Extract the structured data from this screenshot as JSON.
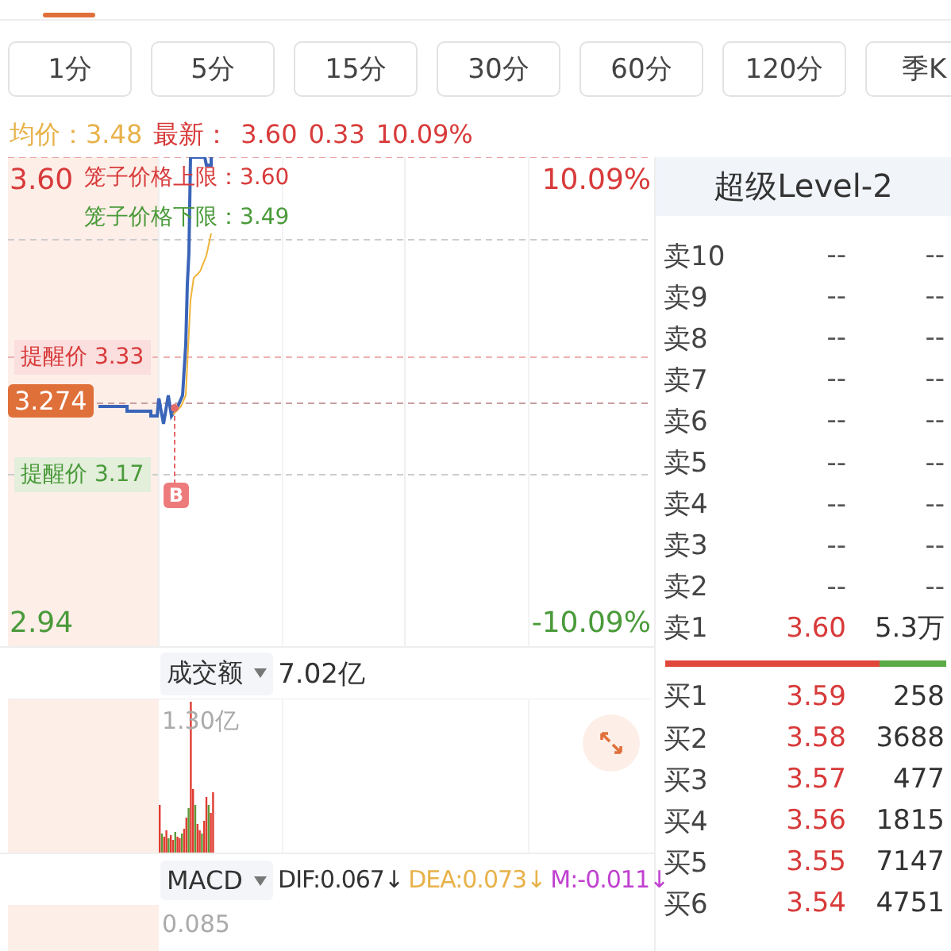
{
  "periods": [
    {
      "label": "1分",
      "selected": false
    },
    {
      "label": "5分",
      "selected": false
    },
    {
      "label": "15分",
      "selected": false
    },
    {
      "label": "30分",
      "selected": false
    },
    {
      "label": "60分",
      "selected": false
    },
    {
      "label": "120分",
      "selected": false
    },
    {
      "label": "季K",
      "selected": false
    }
  ],
  "quote_line": {
    "avg_label": "均价：",
    "avg_value": "3.48",
    "latest_label": "最新：",
    "latest_price": "3.60",
    "change": "0.33",
    "change_pct": "10.09%"
  },
  "price_chart": {
    "top_price": "3.60",
    "top_pct": "10.09%",
    "bottom_price": "2.94",
    "bottom_pct": "-10.09%",
    "cage_upper": "笼子价格上限：3.60",
    "cage_lower": "笼子价格下限：3.49",
    "alerts": [
      {
        "label": "提醒价 3.33",
        "kind": "upper"
      },
      {
        "label": "提醒价 3.17",
        "kind": "lower"
      }
    ],
    "current_price_tag": "3.274",
    "trade_marker": "B"
  },
  "volume_panel": {
    "indicator": "成交额",
    "value": "7.02亿",
    "max_label": "1.30亿"
  },
  "macd_panel": {
    "indicator": "MACD",
    "dif": "DIF:0.067↓",
    "dea": "DEA:0.073↓",
    "m": "M:-0.011↓",
    "max_label": "0.085"
  },
  "order_book": {
    "title": "超级Level-2",
    "asks": [
      {
        "label": "卖10",
        "price": "--",
        "volume": "--",
        "kind": "empty"
      },
      {
        "label": "卖9",
        "price": "--",
        "volume": "--",
        "kind": "empty"
      },
      {
        "label": "卖8",
        "price": "--",
        "volume": "--",
        "kind": "empty"
      },
      {
        "label": "卖7",
        "price": "--",
        "volume": "--",
        "kind": "empty"
      },
      {
        "label": "卖6",
        "price": "--",
        "volume": "--",
        "kind": "empty"
      },
      {
        "label": "卖5",
        "price": "--",
        "volume": "--",
        "kind": "empty"
      },
      {
        "label": "卖4",
        "price": "--",
        "volume": "--",
        "kind": "empty"
      },
      {
        "label": "卖3",
        "price": "--",
        "volume": "--",
        "kind": "empty"
      },
      {
        "label": "卖2",
        "price": "--",
        "volume": "--",
        "kind": "empty"
      },
      {
        "label": "卖1",
        "price": "3.60",
        "volume": "5.3万",
        "kind": "quote"
      }
    ],
    "ratio_bar": {
      "level": 0.76
    },
    "bids": [
      {
        "label": "买1",
        "price": "3.59",
        "volume": "258",
        "kind": "quote"
      },
      {
        "label": "买2",
        "price": "3.58",
        "volume": "3688",
        "kind": "quote"
      },
      {
        "label": "买3",
        "price": "3.57",
        "volume": "477",
        "kind": "quote"
      },
      {
        "label": "买4",
        "price": "3.56",
        "volume": "1815",
        "kind": "quote"
      },
      {
        "label": "买5",
        "price": "3.55",
        "volume": "7147",
        "kind": "quote"
      },
      {
        "label": "买6",
        "price": "3.54",
        "volume": "4751",
        "kind": "quote"
      }
    ]
  }
}
